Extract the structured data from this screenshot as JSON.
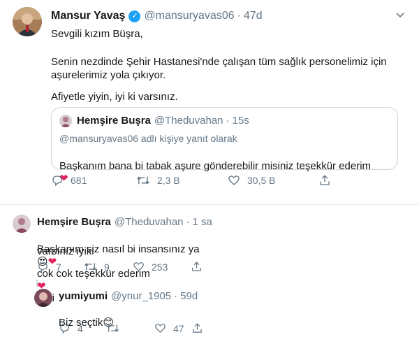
{
  "main_tweet": {
    "author_name": "Mansur Yavaş",
    "handle": "@mansuryavas06",
    "dot": "·",
    "time": "47d",
    "body_line1": "Sevgili kızım Büşra,",
    "body_line2": "Senin nezdinde Şehir Hastanesi'nde çalışan tüm sağlık personelimiz için",
    "body_line3": "aşurelerimiz yola çıkıyor.",
    "body_line4": "Afiyetle yiyin, iyi ki varsınız.",
    "replies": "681",
    "retweets": "2,3 B",
    "likes": "30,5 B"
  },
  "quoted_tweet": {
    "author_name": "Hemşire Buşra",
    "handle": "@Theduvahan",
    "dot": "·",
    "time": "15s",
    "reply_context": "@mansuryavas06 adlı kişiye yanıt olarak",
    "body": "Başkanım bana bi tabak aşure gönderebilir misiniz teşekkür ederim"
  },
  "reply_tweet": {
    "author_name": "Hemşire Buşra",
    "handle": "@Theduvahan",
    "dot": "·",
    "time": "1 sa",
    "body_part1": "Başkanım siz nasıl bi insansınız ya",
    "body_part2": "cok cok teşekkür ederim",
    "body_part3": "iyiki",
    "body_line2": "varsınız iyiki",
    "replies": "7",
    "retweets": "9",
    "likes": "253"
  },
  "nested_reply": {
    "author_name": "yumiyumi",
    "handle": "@ynur_1905",
    "dot": "·",
    "time": "59d",
    "body": "Biz seçtik",
    "replies": "4",
    "retweets": "",
    "likes": "47"
  },
  "colors": {
    "verified": "#1da1f2",
    "muted": "#657786",
    "heart": "#e0245e",
    "border": "#ccd6dd"
  },
  "icons": {
    "reply": "reply-icon",
    "retweet": "retweet-icon",
    "like": "heart-icon",
    "share": "share-icon",
    "more": "chevron-down-icon"
  }
}
